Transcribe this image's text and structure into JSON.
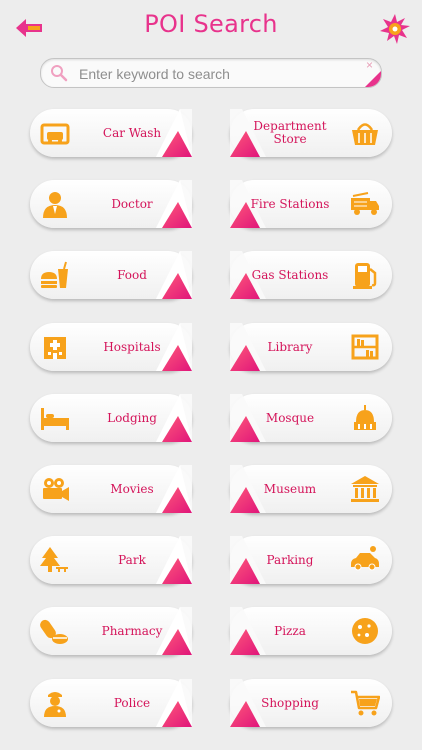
{
  "header": {
    "title": "POI Search"
  },
  "search": {
    "placeholder": "Enter keyword to search",
    "clear_symbol": "×"
  },
  "colors": {
    "accent": "#e8338c",
    "icon": "#f7a21b",
    "label": "#d4145a",
    "background": "#ededed"
  },
  "categories": [
    {
      "label": "Car Wash",
      "icon": "car-wash-icon"
    },
    {
      "label": "Department Store",
      "icon": "basket-icon"
    },
    {
      "label": "Doctor",
      "icon": "doctor-icon"
    },
    {
      "label": "Fire Stations",
      "icon": "fire-truck-icon"
    },
    {
      "label": "Food",
      "icon": "burger-drink-icon"
    },
    {
      "label": "Gas Stations",
      "icon": "gas-pump-icon"
    },
    {
      "label": "Hospitals",
      "icon": "hospital-building-icon"
    },
    {
      "label": "Library",
      "icon": "bookshelf-icon"
    },
    {
      "label": "Lodging",
      "icon": "bed-icon"
    },
    {
      "label": "Mosque",
      "icon": "dome-icon"
    },
    {
      "label": "Movies",
      "icon": "movie-camera-icon"
    },
    {
      "label": "Museum",
      "icon": "museum-icon"
    },
    {
      "label": "Park",
      "icon": "tree-icon"
    },
    {
      "label": "Parking",
      "icon": "parked-car-icon"
    },
    {
      "label": "Pharmacy",
      "icon": "pills-icon"
    },
    {
      "label": "Pizza",
      "icon": "pizza-icon"
    },
    {
      "label": "Police",
      "icon": "police-officer-icon"
    },
    {
      "label": "Shopping",
      "icon": "shopping-cart-icon"
    }
  ]
}
